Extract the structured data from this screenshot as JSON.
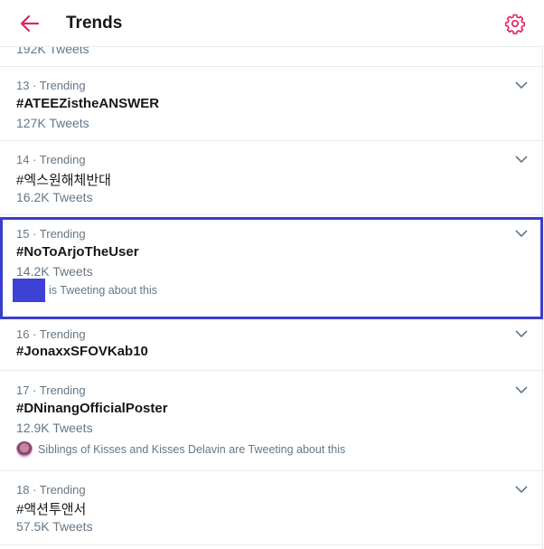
{
  "header": {
    "title": "Trends",
    "back_icon": "arrow-left-icon",
    "settings_icon": "gear-icon",
    "accent_color": "#e0245e"
  },
  "partial_trend": {
    "count": "192K Tweets"
  },
  "trends": [
    {
      "meta": "13 · Trending",
      "name": "#ATEEZistheANSWER",
      "count": "127K Tweets",
      "context": ""
    },
    {
      "meta": "14 · Trending",
      "name": "#엑스원해체반대",
      "count": "16.2K Tweets",
      "context": ""
    },
    {
      "meta": "15 · Trending",
      "name": "#NoToArjoTheUser",
      "count": "14.2K Tweets",
      "context": "is Tweeting about this"
    },
    {
      "meta": "16 · Trending",
      "name": "#JonaxxSFOVKab10",
      "count": "",
      "context": ""
    },
    {
      "meta": "17 · Trending",
      "name": "#DNinangOfficialPoster",
      "count": "12.9K Tweets",
      "context": "Siblings of Kisses and Kisses Delavin are Tweeting about this"
    },
    {
      "meta": "18 · Trending",
      "name": "#액션투앤서",
      "count": "57.5K Tweets",
      "context": ""
    }
  ],
  "selection_color": "#3b3dcc"
}
